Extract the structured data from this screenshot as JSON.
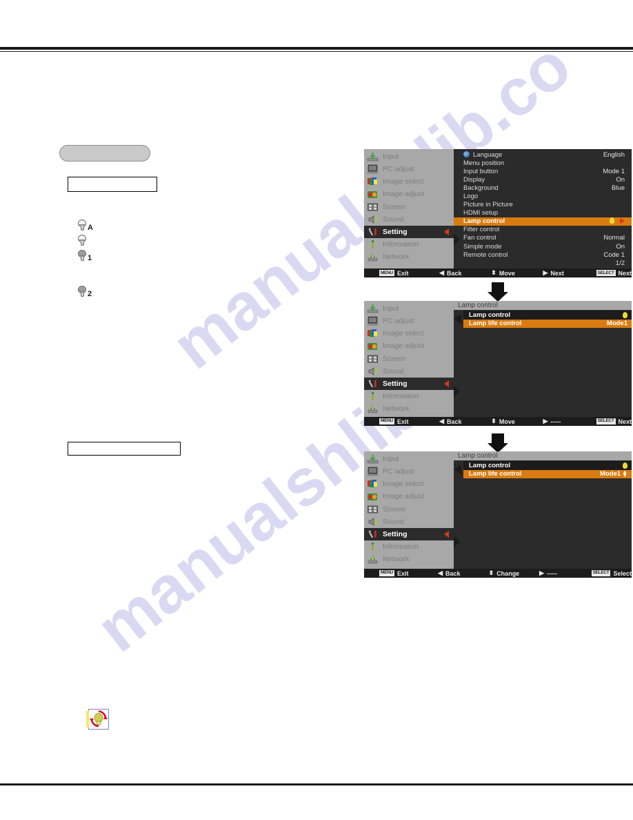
{
  "watermark": {
    "line1": "manualshlib.co",
    "line2": "manualshlib.co"
  },
  "left_column": {
    "lamp_modes": [
      {
        "icon": "lamp-auto-icon",
        "suffix": "A"
      },
      {
        "icon": "lamp-normal-icon",
        "suffix": ""
      },
      {
        "icon": "lamp-eco1-icon",
        "suffix": "1"
      },
      {
        "icon": "lamp-eco2-icon",
        "suffix": "2"
      }
    ],
    "note_icon": "lamp-replace-icon"
  },
  "osd_menus": [
    {
      "id": "setting-menu",
      "sidebar": [
        {
          "label": "Input",
          "icon": "input-icon",
          "active": false
        },
        {
          "label": "PC adjust",
          "icon": "pc-adjust-icon",
          "active": false
        },
        {
          "label": "Image select",
          "icon": "image-select-icon",
          "active": false
        },
        {
          "label": "Image adjust",
          "icon": "image-adjust-icon",
          "active": false
        },
        {
          "label": "Screen",
          "icon": "screen-icon",
          "active": false
        },
        {
          "label": "Sound",
          "icon": "sound-icon",
          "active": false
        },
        {
          "label": "Setting",
          "icon": "setting-icon",
          "active": true
        },
        {
          "label": "Information",
          "icon": "information-icon",
          "active": false
        },
        {
          "label": "Network",
          "icon": "network-icon",
          "active": false
        }
      ],
      "rows": [
        {
          "label": "Language",
          "value": "English",
          "selected": false,
          "icon": "globe-icon"
        },
        {
          "label": "Menu position",
          "value": "",
          "selected": false
        },
        {
          "label": "Input button",
          "value": "Mode 1",
          "selected": false
        },
        {
          "label": "Display",
          "value": "On",
          "selected": false
        },
        {
          "label": "Background",
          "value": "Blue",
          "selected": false
        },
        {
          "label": "Logo",
          "value": "",
          "selected": false
        },
        {
          "label": "Picture in Picture",
          "value": "",
          "selected": false
        },
        {
          "label": "HDMI setup",
          "value": "",
          "selected": false
        },
        {
          "label": "Lamp control",
          "value": "",
          "selected": true,
          "icon": "lamp-icon",
          "arrow": "right-arrow-icon"
        },
        {
          "label": "Filter control",
          "value": "",
          "selected": false
        },
        {
          "label": "Fan control",
          "value": "Normal",
          "selected": false
        },
        {
          "label": "Simple mode",
          "value": "On",
          "selected": false
        },
        {
          "label": "Remote control",
          "value": "Code 1",
          "selected": false
        }
      ],
      "page_indicator": "1/2",
      "footer": [
        {
          "badge": "MENU",
          "glyph": "",
          "label": "Exit"
        },
        {
          "badge": "",
          "glyph": "◀",
          "label": "Back"
        },
        {
          "badge": "",
          "glyph": "⬍",
          "label": "Move"
        },
        {
          "badge": "",
          "glyph": "▶",
          "label": "Next"
        },
        {
          "badge": "SELECT",
          "glyph": "",
          "label": "Next"
        }
      ]
    },
    {
      "id": "lamp-control-submenu",
      "sidebar": [
        {
          "label": "Input",
          "icon": "input-icon",
          "active": false
        },
        {
          "label": "PC adjust",
          "icon": "pc-adjust-icon",
          "active": false
        },
        {
          "label": "Image select",
          "icon": "image-select-icon",
          "active": false
        },
        {
          "label": "Image adjust",
          "icon": "image-adjust-icon",
          "active": false
        },
        {
          "label": "Screen",
          "icon": "screen-icon",
          "active": false
        },
        {
          "label": "Sound",
          "icon": "sound-icon",
          "active": false
        },
        {
          "label": "Setting",
          "icon": "setting-icon",
          "active": true
        },
        {
          "label": "Information",
          "icon": "information-icon",
          "active": false
        },
        {
          "label": "Network",
          "icon": "network-icon",
          "active": false
        }
      ],
      "panel_title": "Lamp control",
      "rows": [
        {
          "label": "Lamp control",
          "value": "",
          "selected": false,
          "icon": "lamp-icon"
        },
        {
          "label": "Lamp life control",
          "value": "Mode1",
          "selected": true
        }
      ],
      "footer": [
        {
          "badge": "MENU",
          "glyph": "",
          "label": "Exit"
        },
        {
          "badge": "",
          "glyph": "◀",
          "label": "Back"
        },
        {
          "badge": "",
          "glyph": "⬍",
          "label": "Move"
        },
        {
          "badge": "",
          "glyph": "▶",
          "label": "-----"
        },
        {
          "badge": "SELECT",
          "glyph": "",
          "label": "Next"
        }
      ]
    },
    {
      "id": "lamp-life-control-adjust",
      "sidebar": [
        {
          "label": "Input",
          "icon": "input-icon",
          "active": false
        },
        {
          "label": "PC adjust",
          "icon": "pc-adjust-icon",
          "active": false
        },
        {
          "label": "Image select",
          "icon": "image-select-icon",
          "active": false
        },
        {
          "label": "Image adjust",
          "icon": "image-adjust-icon",
          "active": false
        },
        {
          "label": "Screen",
          "icon": "screen-icon",
          "active": false
        },
        {
          "label": "Sound",
          "icon": "sound-icon",
          "active": false
        },
        {
          "label": "Setting",
          "icon": "setting-icon",
          "active": true
        },
        {
          "label": "Information",
          "icon": "information-icon",
          "active": false
        },
        {
          "label": "Network",
          "icon": "network-icon",
          "active": false
        }
      ],
      "panel_title": "Lamp control",
      "rows": [
        {
          "label": "Lamp control",
          "value": "",
          "selected": false,
          "icon": "lamp-icon"
        },
        {
          "label": "Lamp life control",
          "value": "Mode1",
          "selected": true,
          "spinner": true
        }
      ],
      "footer": [
        {
          "badge": "MENU",
          "glyph": "",
          "label": "Exit"
        },
        {
          "badge": "",
          "glyph": "◀",
          "label": "Back"
        },
        {
          "badge": "",
          "glyph": "⬍",
          "label": "Change"
        },
        {
          "badge": "",
          "glyph": "▶",
          "label": "-----"
        },
        {
          "badge": "SELECT",
          "glyph": "",
          "label": "Select"
        }
      ]
    }
  ],
  "colors": {
    "highlight": "#d97b10",
    "sidebar_bg": "#a8a8a8",
    "panel_bg": "#2b2b2b",
    "footer_bg": "#1c1c1c",
    "caret_red": "#d83a17",
    "lamp_yellow": "#e8dc34"
  }
}
